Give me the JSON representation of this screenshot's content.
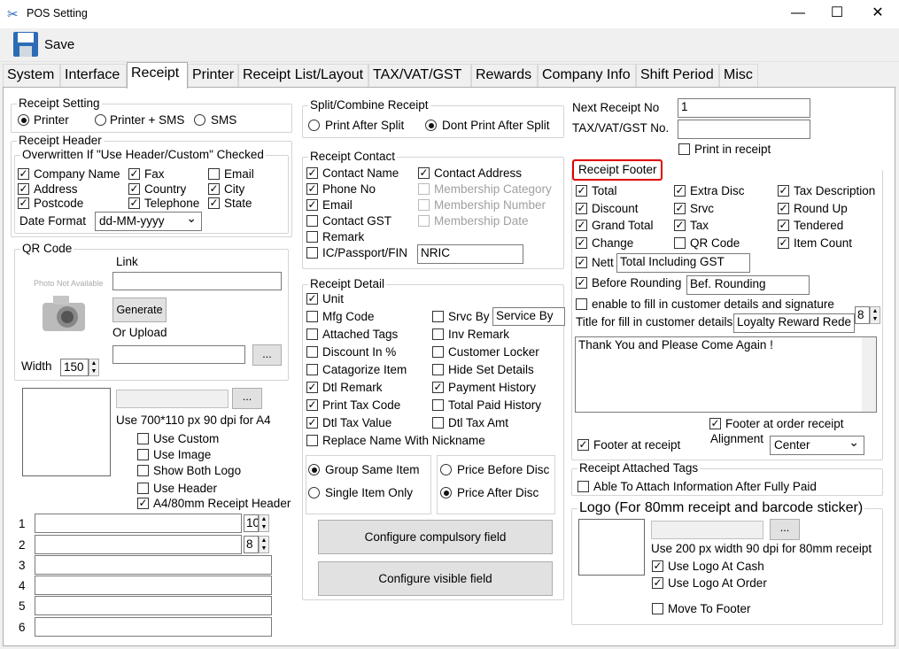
{
  "window": {
    "title": "POS Setting",
    "minimize": "—",
    "maximize": "☐",
    "close": "✕"
  },
  "toolbar": {
    "save_label": "Save"
  },
  "tabs": [
    "System",
    "Interface",
    "Receipt",
    "Printer",
    "Receipt List/Layout",
    "TAX/VAT/GST",
    "Rewards",
    "Company Info",
    "Shift Period",
    "Misc"
  ],
  "receipt_setting": {
    "title": "Receipt Setting",
    "options": [
      "Printer",
      "Printer + SMS",
      "SMS"
    ],
    "selected": "Printer"
  },
  "receipt_header": {
    "title": "Receipt Header",
    "overwritten_title": "Overwritten If \"Use Header/Custom\" Checked",
    "items": [
      {
        "label": "Company Name",
        "checked": true
      },
      {
        "label": "Fax",
        "checked": true
      },
      {
        "label": "Email",
        "checked": false
      },
      {
        "label": "Address",
        "checked": true
      },
      {
        "label": "Country",
        "checked": true
      },
      {
        "label": "City",
        "checked": true
      },
      {
        "label": "Postcode",
        "checked": true
      },
      {
        "label": "Telephone",
        "checked": true
      },
      {
        "label": "State",
        "checked": true
      }
    ],
    "date_format_label": "Date Format",
    "date_format_value": "dd-MM-yyyy"
  },
  "qr_code": {
    "title": "QR Code",
    "link_label": "Link",
    "photo_placeholder": "Photo Not Available",
    "generate_label": "Generate",
    "or_upload_label": "Or Upload",
    "browse_label": "...",
    "width_label": "Width",
    "width_value": "150"
  },
  "logo_left": {
    "browse_label": "...",
    "hint": "Use 700*110 px 90 dpi for A4",
    "options": [
      {
        "label": "Use Custom",
        "checked": false
      },
      {
        "label": "Use Image",
        "checked": false
      },
      {
        "label": "Show Both Logo",
        "checked": false
      },
      {
        "label": "Use Header",
        "checked": false
      },
      {
        "label": "A4/80mm Receipt Header",
        "checked": true
      }
    ]
  },
  "header_lines": [
    {
      "num": "1",
      "size": "10"
    },
    {
      "num": "2",
      "size": "8"
    },
    {
      "num": "3"
    },
    {
      "num": "4"
    },
    {
      "num": "5"
    },
    {
      "num": "6"
    }
  ],
  "split_combine": {
    "title": "Split/Combine Receipt",
    "options": [
      "Print After Split",
      "Dont Print After Split"
    ],
    "selected": "Dont Print After Split"
  },
  "receipt_contact": {
    "title": "Receipt Contact",
    "left": [
      {
        "label": "Contact Name",
        "checked": true
      },
      {
        "label": "Phone No",
        "checked": true
      },
      {
        "label": "Email",
        "checked": true
      },
      {
        "label": "Contact GST",
        "checked": false
      },
      {
        "label": "Remark",
        "checked": false
      },
      {
        "label": "IC/Passport/FIN",
        "checked": false
      }
    ],
    "right": [
      {
        "label": "Contact Address",
        "checked": true,
        "disabled": false
      },
      {
        "label": "Membership Category",
        "checked": false,
        "disabled": true
      },
      {
        "label": "Membership Number",
        "checked": false,
        "disabled": true
      },
      {
        "label": "Membership Date",
        "checked": false,
        "disabled": true
      }
    ],
    "nric_value": "NRIC"
  },
  "receipt_detail": {
    "title": "Receipt Detail",
    "left": [
      {
        "label": "Unit",
        "checked": true
      },
      {
        "label": "Mfg Code",
        "checked": false
      },
      {
        "label": "Attached Tags",
        "checked": false
      },
      {
        "label": "Discount In %",
        "checked": false
      },
      {
        "label": "Catagorize Item",
        "checked": false
      },
      {
        "label": "Dtl Remark",
        "checked": true
      },
      {
        "label": "Print Tax Code",
        "checked": true
      },
      {
        "label": "Dtl Tax Value",
        "checked": true
      },
      {
        "label": "Replace Name With Nickname",
        "checked": false
      }
    ],
    "right": [
      {
        "label": "Srvc By",
        "checked": false
      },
      {
        "label": "Inv Remark",
        "checked": false
      },
      {
        "label": "Customer Locker",
        "checked": false
      },
      {
        "label": "Hide Set Details",
        "checked": false
      },
      {
        "label": "Payment History",
        "checked": true
      },
      {
        "label": "Total Paid History",
        "checked": false
      },
      {
        "label": "Dtl Tax Amt",
        "checked": false
      }
    ],
    "srvc_by_value": "Service By",
    "group_options": [
      "Group Same Item",
      "Single Item Only"
    ],
    "group_selected": "Group Same Item",
    "price_options": [
      "Price Before Disc",
      "Price After Disc"
    ],
    "price_selected": "Price After Disc",
    "configure_compulsory": "Configure compulsory field",
    "configure_visible": "Configure visible field"
  },
  "next_receipt": {
    "label": "Next Receipt No",
    "value": "1",
    "tax_label": "TAX/VAT/GST No.",
    "tax_value": "",
    "print_label": "Print in receipt"
  },
  "receipt_footer": {
    "title": "Receipt Footer",
    "accent": "#e00000",
    "items": [
      {
        "label": "Total",
        "checked": true
      },
      {
        "label": "Extra Disc",
        "checked": true
      },
      {
        "label": "Tax Description",
        "checked": true
      },
      {
        "label": "Discount",
        "checked": true
      },
      {
        "label": "Srvc",
        "checked": true
      },
      {
        "label": "Round Up",
        "checked": true
      },
      {
        "label": "Grand Total",
        "checked": true
      },
      {
        "label": "Tax",
        "checked": true
      },
      {
        "label": "Tendered",
        "checked": true
      },
      {
        "label": "Change",
        "checked": true
      },
      {
        "label": "QR Code",
        "checked": false
      },
      {
        "label": "Item Count",
        "checked": true
      }
    ],
    "nett_label": "Nett",
    "nett_value": "Total Including GST",
    "before_rounding_label": "Before Rounding",
    "before_rounding_value": "Bef. Rounding",
    "enable_fill_label": "enable to fill in customer details and signature",
    "title_fill_label": "Title for fill in customer details",
    "title_fill_value": "Loyalty Reward Rede",
    "title_fill_size": "8",
    "message": "Thank You and Please Come Again !",
    "footer_order_label": "Footer at order receipt",
    "footer_receipt_label": "Footer at receipt",
    "alignment_label": "Alignment",
    "alignment_value": "Center"
  },
  "attached_tags": {
    "title": "Receipt Attached Tags",
    "label": "Able To Attach Information After Fully Paid"
  },
  "logo_right": {
    "title": "Logo (For 80mm receipt and barcode sticker)",
    "browse_label": "...",
    "hint": "Use 200 px width 90 dpi for 80mm receipt",
    "options": [
      {
        "label": "Use Logo At Cash",
        "checked": true
      },
      {
        "label": "Use Logo At Order",
        "checked": true
      },
      {
        "label": "Move To Footer",
        "checked": false
      }
    ]
  }
}
